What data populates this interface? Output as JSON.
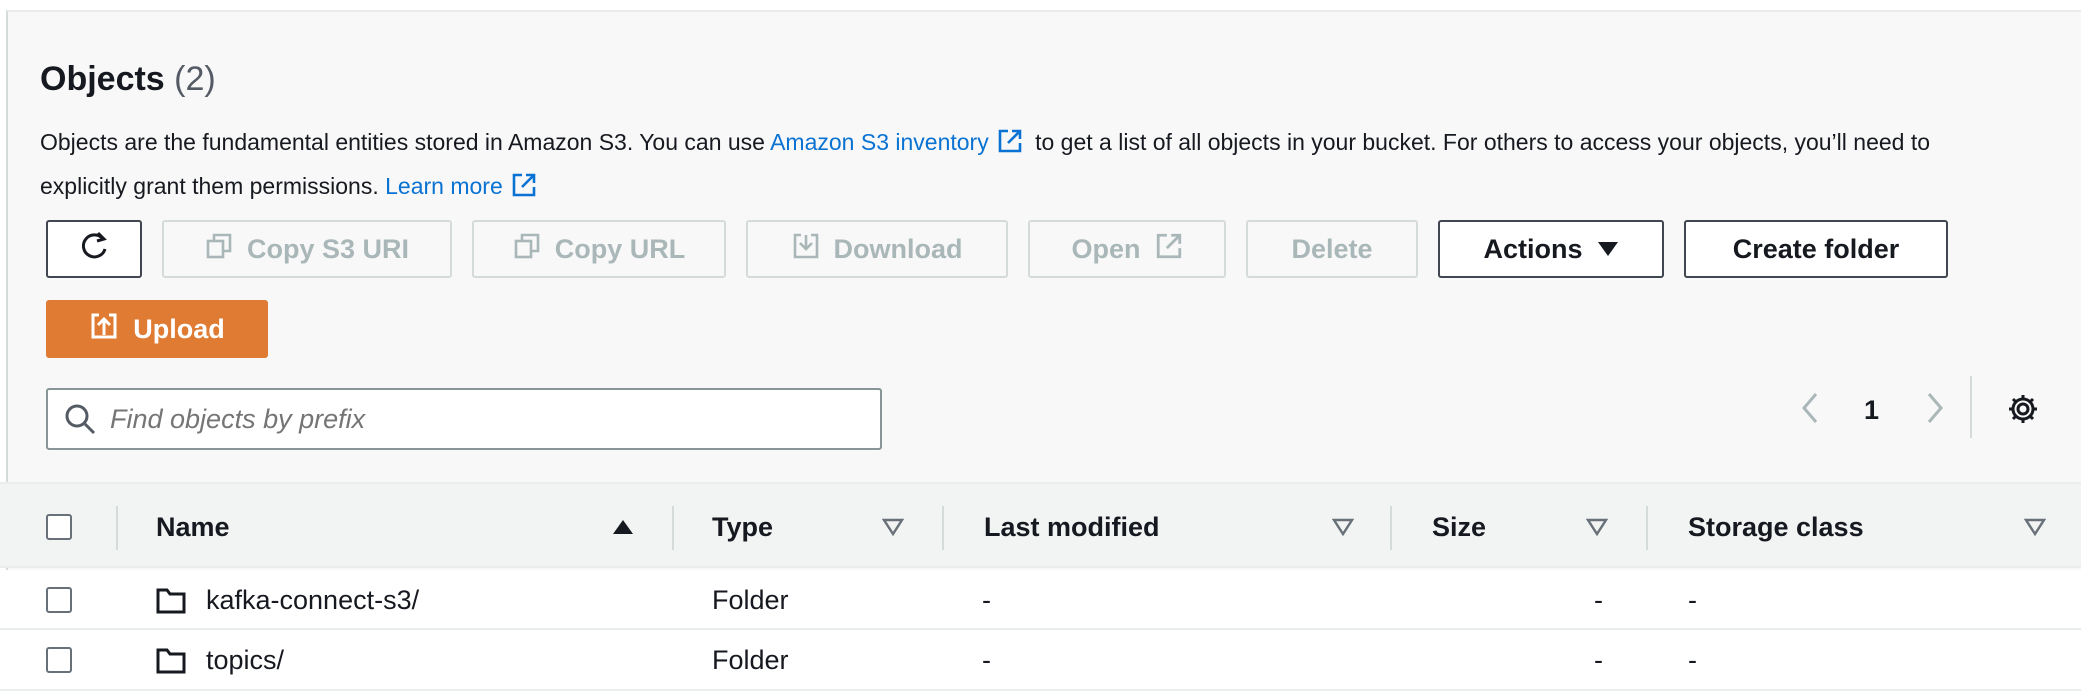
{
  "header": {
    "title": "Objects",
    "count": "(2)",
    "desc_part1": "Objects are the fundamental entities stored in Amazon S3. You can use ",
    "desc_link1": "Amazon S3 inventory",
    "desc_part2": " to get a list of all objects in your bucket. For others to access your objects, you’ll need to explicitly grant them permissions. ",
    "desc_link2": "Learn more"
  },
  "toolbar": {
    "copy_s3_uri": "Copy S3 URI",
    "copy_url": "Copy URL",
    "download": "Download",
    "open": "Open",
    "delete": "Delete",
    "actions": "Actions",
    "create_folder": "Create folder",
    "upload": "Upload"
  },
  "search": {
    "placeholder": "Find objects by prefix"
  },
  "pagination": {
    "current_page": "1"
  },
  "table": {
    "columns": [
      "Name",
      "Type",
      "Last modified",
      "Size",
      "Storage class"
    ],
    "rows": [
      {
        "name": "kafka-connect-s3/",
        "type": "Folder",
        "last_modified": "-",
        "size": "-",
        "storage_class": "-"
      },
      {
        "name": "topics/",
        "type": "Folder",
        "last_modified": "-",
        "size": "-",
        "storage_class": "-"
      }
    ]
  },
  "colors": {
    "accent": "#e07b33",
    "link": "#0972d3",
    "text": "#16191f",
    "disabled": "#aab7b8"
  }
}
